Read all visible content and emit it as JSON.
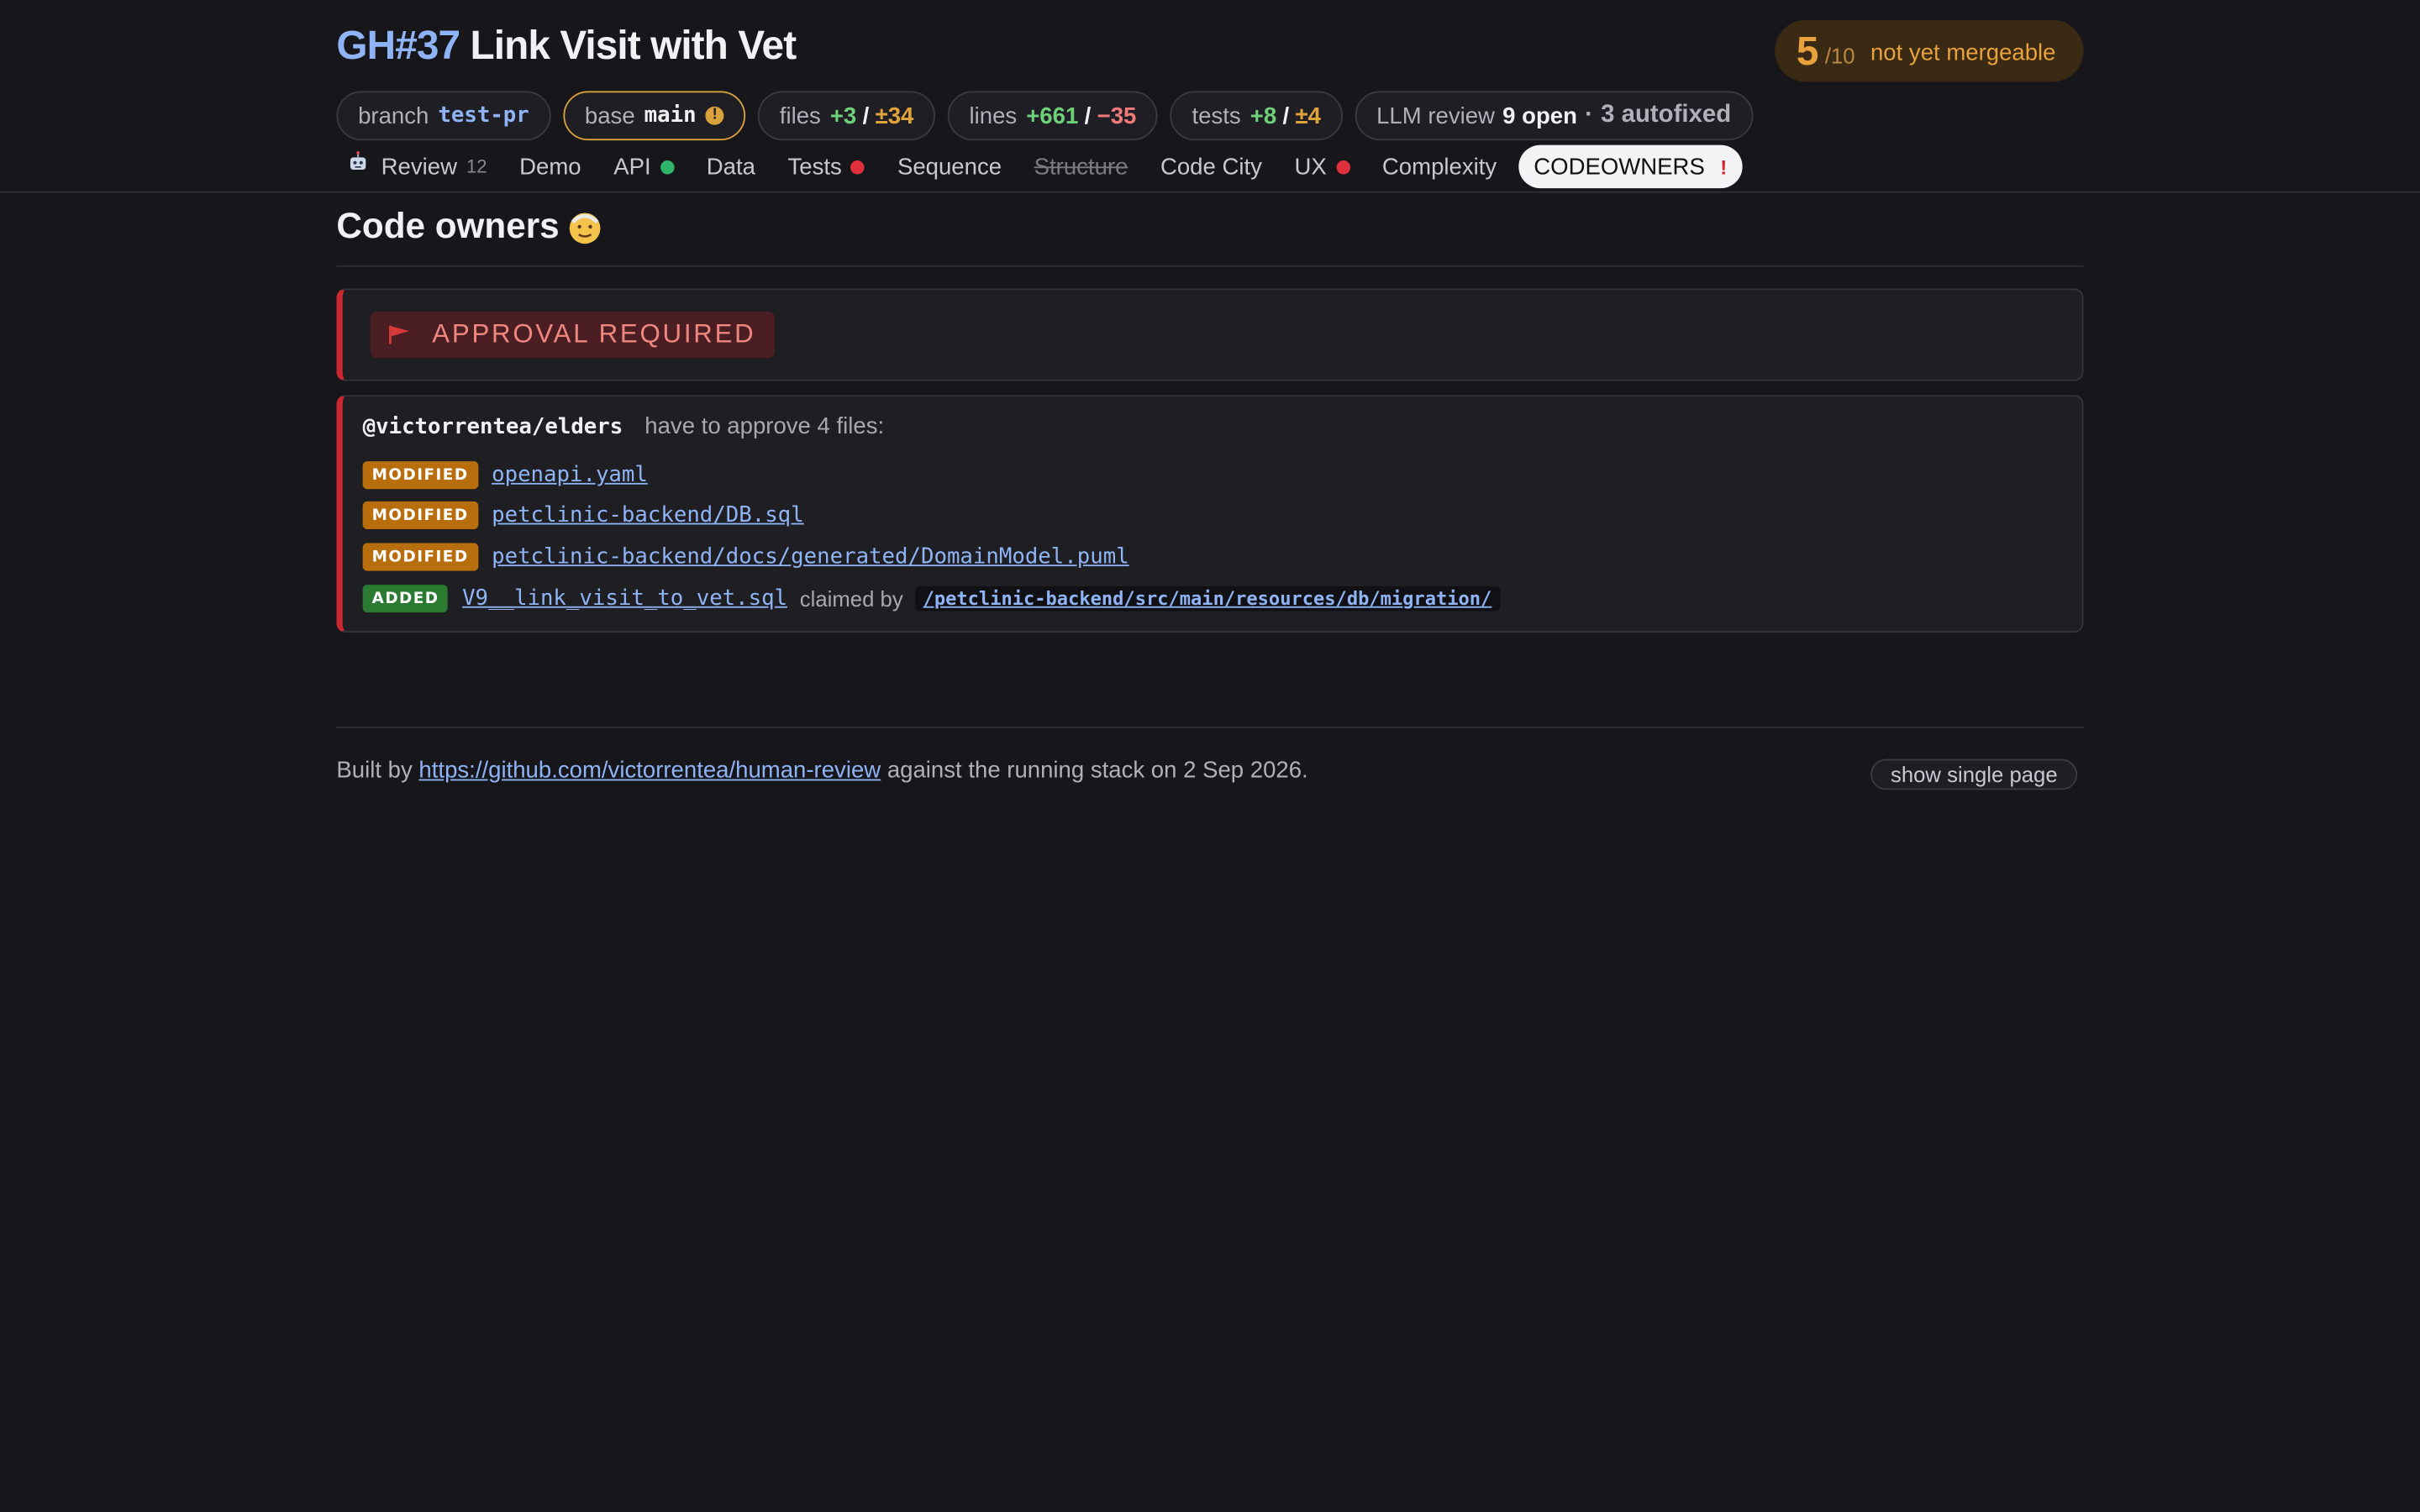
{
  "header": {
    "pr_id": "GH#37",
    "title": "Link Visit with Vet",
    "score": {
      "value": "5",
      "max": "/10",
      "status": "not yet mergeable",
      "color": "#e9a13d"
    }
  },
  "chips": {
    "branch_label": "branch",
    "branch_value": "test-pr",
    "base_label": "base",
    "base_value": "main",
    "base_warning_icon": "warning-icon",
    "files_label": "files",
    "files_added": "+3",
    "files_sep": "/",
    "files_changed": "±34",
    "lines_label": "lines",
    "lines_added": "+661",
    "lines_sep": "/",
    "lines_removed": "−35",
    "tests_label": "tests",
    "tests_added": "+8",
    "tests_sep": "/",
    "tests_changed": "±4",
    "llm_label": "LLM review",
    "llm_open": "9 open",
    "llm_sep": "·",
    "llm_autofixed": "3 autofixed"
  },
  "tabs": [
    {
      "label": "Review",
      "count": "12",
      "icon": "robot-icon"
    },
    {
      "label": "Demo"
    },
    {
      "label": "API",
      "status": "green"
    },
    {
      "label": "Data"
    },
    {
      "label": "Tests",
      "status": "red"
    },
    {
      "label": "Sequence"
    },
    {
      "label": "Structure",
      "disabled": true
    },
    {
      "label": "Code City"
    },
    {
      "label": "UX",
      "status": "red"
    },
    {
      "label": "Complexity"
    },
    {
      "label": "CODEOWNERS",
      "active": true,
      "marker": "!"
    }
  ],
  "section": {
    "title": "Code owners",
    "title_icon": "old-man-face-icon"
  },
  "alert": {
    "icon": "flag-icon",
    "text": "APPROVAL REQUIRED"
  },
  "owners": {
    "team": "@victorrentea/elders",
    "note": "have to approve 4 files:",
    "files": [
      {
        "status": "MODIFIED",
        "path": "openapi.yaml"
      },
      {
        "status": "MODIFIED",
        "path": "petclinic-backend/DB.sql"
      },
      {
        "status": "MODIFIED",
        "path": "petclinic-backend/docs/generated/DomainModel.puml"
      },
      {
        "status": "ADDED",
        "path": "V9__link_visit_to_vet.sql",
        "claimed_label": "claimed by",
        "claimed_path": "/petclinic-backend/src/main/resources/db/migration/"
      }
    ]
  },
  "footer": {
    "prefix": "Built by",
    "link": "https://github.com/victorrentea/human-review",
    "suffix": "against the running stack on 2 Sep 2026.",
    "single_page_button": "show single page"
  }
}
